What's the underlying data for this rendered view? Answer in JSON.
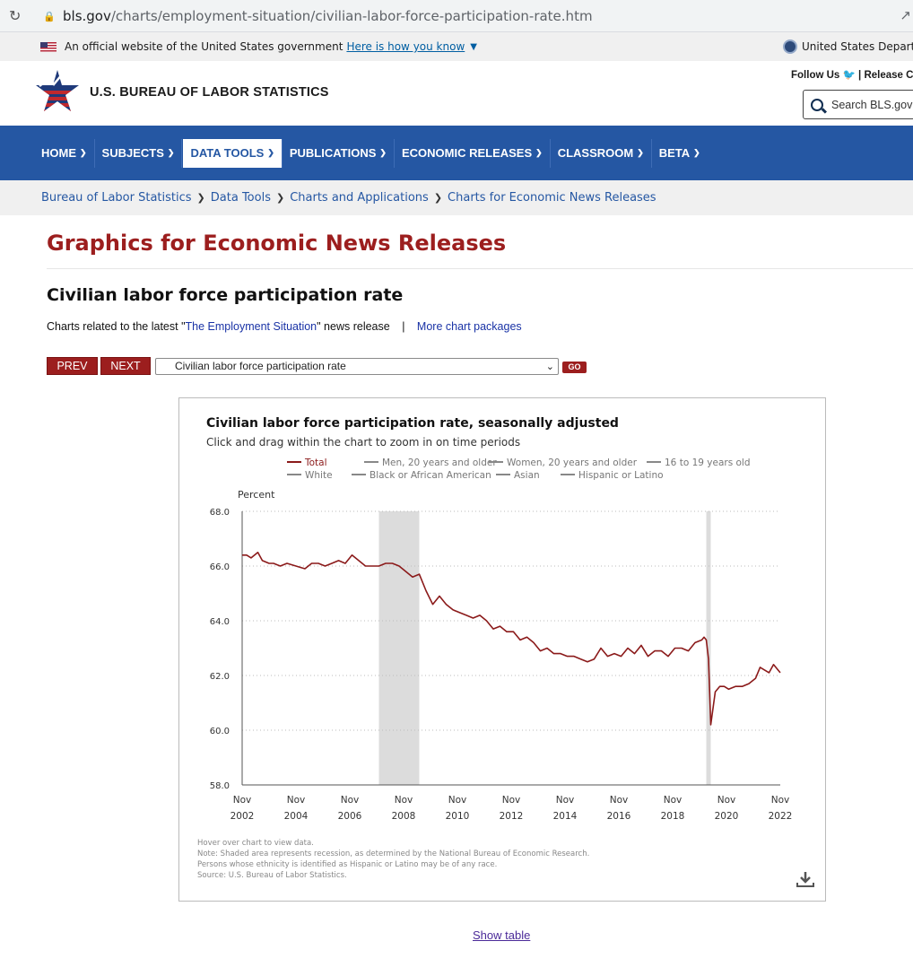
{
  "browser": {
    "url_host": "bls.gov",
    "url_path": "/charts/employment-situation/civilian-labor-force-participation-rate.htm"
  },
  "gov_banner": {
    "text": "An official website of the United States government",
    "link": "Here is how you know",
    "right_text": "United States Departm"
  },
  "header": {
    "site_title": "U.S. BUREAU OF LABOR STATISTICS",
    "follow_us": "Follow Us",
    "release_cal": "| Release Cal",
    "search_placeholder": "Search BLS.gov"
  },
  "nav": {
    "items": [
      {
        "label": "HOME"
      },
      {
        "label": "SUBJECTS"
      },
      {
        "label": "DATA TOOLS"
      },
      {
        "label": "PUBLICATIONS"
      },
      {
        "label": "ECONOMIC RELEASES"
      },
      {
        "label": "CLASSROOM"
      },
      {
        "label": "BETA"
      }
    ]
  },
  "breadcrumb": [
    "Bureau of Labor Statistics",
    "Data Tools",
    "Charts and Applications",
    "Charts for Economic News Releases"
  ],
  "page": {
    "h1": "Graphics for Economic News Releases",
    "h2": "Civilian labor force participation rate",
    "related_prefix": "Charts related to the latest \"",
    "related_link": "The Employment Situation",
    "related_suffix": "\" news release",
    "bar": "|",
    "more_link": "More chart packages",
    "prev": "PREV",
    "next": "NEXT",
    "select_value": "Civilian labor force participation rate",
    "go": "GO",
    "show_table": "Show table"
  },
  "chart_data": {
    "type": "line",
    "title": "Civilian labor force participation rate, seasonally adjusted",
    "subtitle": "Click and drag within the chart to zoom in on time periods",
    "ylabel": "Percent",
    "xlabel": "",
    "ylim": [
      58.0,
      68.0
    ],
    "yticks": [
      "68.0",
      "66.0",
      "64.0",
      "62.0",
      "60.0",
      "58.0"
    ],
    "xticks": [
      {
        "top": "Nov",
        "bottom": "2002"
      },
      {
        "top": "Nov",
        "bottom": "2004"
      },
      {
        "top": "Nov",
        "bottom": "2006"
      },
      {
        "top": "Nov",
        "bottom": "2008"
      },
      {
        "top": "Nov",
        "bottom": "2010"
      },
      {
        "top": "Nov",
        "bottom": "2012"
      },
      {
        "top": "Nov",
        "bottom": "2014"
      },
      {
        "top": "Nov",
        "bottom": "2016"
      },
      {
        "top": "Nov",
        "bottom": "2018"
      },
      {
        "top": "Nov",
        "bottom": "2020"
      },
      {
        "top": "Nov",
        "bottom": "2022"
      }
    ],
    "legend": [
      {
        "name": "Total",
        "color": "#8b1a1a",
        "active": true
      },
      {
        "name": "Men, 20 years and older",
        "color": "#888888",
        "active": false
      },
      {
        "name": "Women, 20 years and older",
        "color": "#888888",
        "active": false
      },
      {
        "name": "16 to 19 years old",
        "color": "#888888",
        "active": false
      },
      {
        "name": "White",
        "color": "#888888",
        "active": false
      },
      {
        "name": "Black or African American",
        "color": "#888888",
        "active": false
      },
      {
        "name": "Asian",
        "color": "#888888",
        "active": false
      },
      {
        "name": "Hispanic or Latino",
        "color": "#888888",
        "active": false
      }
    ],
    "recessions": [
      {
        "start": "Dec 2007",
        "end": "Jun 2009"
      },
      {
        "start": "Feb 2020",
        "end": "Apr 2020"
      }
    ],
    "series": [
      {
        "name": "Total",
        "color": "#8b1a1a",
        "points": [
          [
            "2002-11",
            66.4
          ],
          [
            "2003-01",
            66.4
          ],
          [
            "2003-03",
            66.3
          ],
          [
            "2003-06",
            66.5
          ],
          [
            "2003-08",
            66.2
          ],
          [
            "2003-11",
            66.1
          ],
          [
            "2004-01",
            66.1
          ],
          [
            "2004-04",
            66.0
          ],
          [
            "2004-07",
            66.1
          ],
          [
            "2004-11",
            66.0
          ],
          [
            "2005-03",
            65.9
          ],
          [
            "2005-06",
            66.1
          ],
          [
            "2005-09",
            66.1
          ],
          [
            "2005-12",
            66.0
          ],
          [
            "2006-03",
            66.1
          ],
          [
            "2006-06",
            66.2
          ],
          [
            "2006-09",
            66.1
          ],
          [
            "2006-12",
            66.4
          ],
          [
            "2007-03",
            66.2
          ],
          [
            "2007-06",
            66.0
          ],
          [
            "2007-09",
            66.0
          ],
          [
            "2007-12",
            66.0
          ],
          [
            "2008-03",
            66.1
          ],
          [
            "2008-06",
            66.1
          ],
          [
            "2008-09",
            66.0
          ],
          [
            "2008-12",
            65.8
          ],
          [
            "2009-03",
            65.6
          ],
          [
            "2009-06",
            65.7
          ],
          [
            "2009-09",
            65.1
          ],
          [
            "2009-12",
            64.6
          ],
          [
            "2010-03",
            64.9
          ],
          [
            "2010-06",
            64.6
          ],
          [
            "2010-09",
            64.4
          ],
          [
            "2010-12",
            64.3
          ],
          [
            "2011-03",
            64.2
          ],
          [
            "2011-06",
            64.1
          ],
          [
            "2011-09",
            64.2
          ],
          [
            "2011-12",
            64.0
          ],
          [
            "2012-03",
            63.7
          ],
          [
            "2012-06",
            63.8
          ],
          [
            "2012-09",
            63.6
          ],
          [
            "2012-12",
            63.6
          ],
          [
            "2013-03",
            63.3
          ],
          [
            "2013-06",
            63.4
          ],
          [
            "2013-09",
            63.2
          ],
          [
            "2013-12",
            62.9
          ],
          [
            "2014-03",
            63.0
          ],
          [
            "2014-06",
            62.8
          ],
          [
            "2014-09",
            62.8
          ],
          [
            "2014-12",
            62.7
          ],
          [
            "2015-03",
            62.7
          ],
          [
            "2015-06",
            62.6
          ],
          [
            "2015-09",
            62.5
          ],
          [
            "2015-12",
            62.6
          ],
          [
            "2016-03",
            63.0
          ],
          [
            "2016-06",
            62.7
          ],
          [
            "2016-09",
            62.8
          ],
          [
            "2016-12",
            62.7
          ],
          [
            "2017-03",
            63.0
          ],
          [
            "2017-06",
            62.8
          ],
          [
            "2017-09",
            63.1
          ],
          [
            "2017-12",
            62.7
          ],
          [
            "2018-03",
            62.9
          ],
          [
            "2018-06",
            62.9
          ],
          [
            "2018-09",
            62.7
          ],
          [
            "2018-12",
            63.0
          ],
          [
            "2019-03",
            63.0
          ],
          [
            "2019-06",
            62.9
          ],
          [
            "2019-09",
            63.2
          ],
          [
            "2019-12",
            63.3
          ],
          [
            "2020-01",
            63.4
          ],
          [
            "2020-02",
            63.3
          ],
          [
            "2020-03",
            62.6
          ],
          [
            "2020-04",
            60.2
          ],
          [
            "2020-05",
            60.8
          ],
          [
            "2020-06",
            61.4
          ],
          [
            "2020-08",
            61.6
          ],
          [
            "2020-10",
            61.6
          ],
          [
            "2020-12",
            61.5
          ],
          [
            "2021-03",
            61.6
          ],
          [
            "2021-06",
            61.6
          ],
          [
            "2021-09",
            61.7
          ],
          [
            "2021-12",
            61.9
          ],
          [
            "2022-02",
            62.3
          ],
          [
            "2022-04",
            62.2
          ],
          [
            "2022-06",
            62.1
          ],
          [
            "2022-08",
            62.4
          ],
          [
            "2022-10",
            62.2
          ],
          [
            "2022-11",
            62.1
          ]
        ]
      }
    ],
    "notes": [
      "Hover over chart to view data.",
      "Note: Shaded area represents recession, as determined by the National Bureau of Economic Research.",
      "Persons whose ethnicity is identified as Hispanic or Latino may be of any race.",
      "Source: U.S. Bureau of Labor Statistics."
    ]
  }
}
